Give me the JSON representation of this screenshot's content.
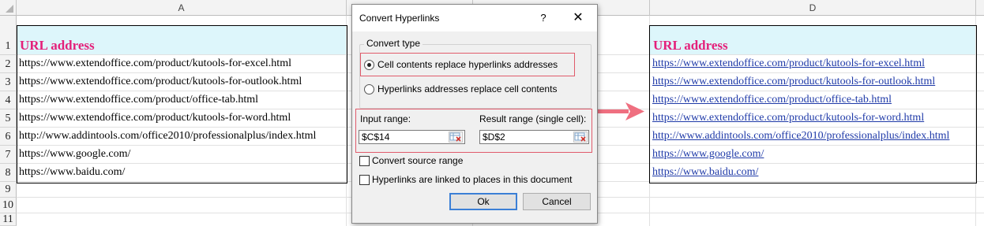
{
  "columns": [
    "A",
    "D"
  ],
  "rows": [
    "1",
    "2",
    "3",
    "4",
    "5",
    "6",
    "7",
    "8",
    "9",
    "10",
    "11"
  ],
  "col_a": {
    "header": "URL address",
    "urls": [
      "https://www.extendoffice.com/product/kutools-for-excel.html",
      "https://www.extendoffice.com/product/kutools-for-outlook.html",
      "https://www.extendoffice.com/product/office-tab.html",
      "https://www.extendoffice.com/product/kutools-for-word.html",
      "http://www.addintools.com/office2010/professionalplus/index.html",
      "https://www.google.com/",
      "https://www.baidu.com/"
    ]
  },
  "col_d": {
    "header": "URL address",
    "links": [
      "https://www.extendoffice.com/product/kutools-for-excel.html",
      "https://www.extendoffice.com/product/kutools-for-outlook.html",
      "https://www.extendoffice.com/product/office-tab.html",
      "https://www.extendoffice.com/product/kutools-for-word.html",
      "http://www.addintools.com/office2010/professionalplus/index.html",
      "https://www.google.com/",
      "https://www.baidu.com/"
    ]
  },
  "dialog": {
    "title": "Convert Hyperlinks",
    "help": "?",
    "close": "✕",
    "group_title": "Convert type",
    "option1": "Cell contents replace hyperlinks addresses",
    "option2": "Hyperlinks addresses replace cell contents",
    "option1_selected": true,
    "input_label": "Input range:",
    "input_value": "$C$14",
    "result_label": "Result range (single cell):",
    "result_value": "$D$2",
    "check1": "Convert source range",
    "check2": "Hyperlinks are linked to places in this document",
    "check1_checked": false,
    "check2_checked": false,
    "ok": "Ok",
    "cancel": "Cancel"
  },
  "colors": {
    "header_fill": "#ddf6fb",
    "header_text": "#e4207a",
    "link": "#1f3aa8",
    "highlight": "#e05b6b",
    "arrow": "#ef6f80"
  },
  "icons": [
    "range-select-icon",
    "right-arrow-icon"
  ]
}
